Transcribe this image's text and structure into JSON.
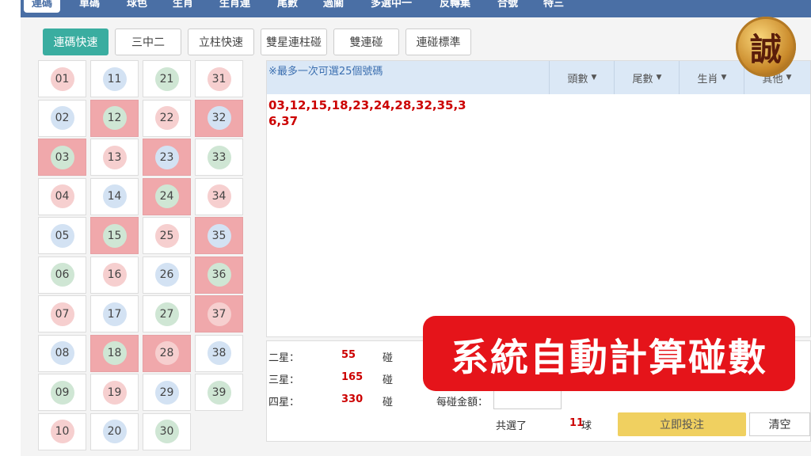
{
  "nav": {
    "tabs": [
      "連碼",
      "單碼",
      "球色",
      "生肖",
      "生肖連",
      "尾數",
      "過關",
      "多選中一",
      "反轉集",
      "合號",
      "特三"
    ]
  },
  "toolbar": {
    "buttons": [
      "連碼快速",
      "三中二",
      "立柱快速",
      "雙星連柱碰",
      "雙連碰",
      "連碰標準"
    ],
    "active": "連碼快速"
  },
  "grid": {
    "numbers": [
      [
        "01",
        "11",
        "21",
        "31"
      ],
      [
        "02",
        "12",
        "22",
        "32"
      ],
      [
        "03",
        "13",
        "23",
        "33"
      ],
      [
        "04",
        "14",
        "24",
        "34"
      ],
      [
        "05",
        "15",
        "25",
        "35"
      ],
      [
        "06",
        "16",
        "26",
        "36"
      ],
      [
        "07",
        "17",
        "27",
        "37"
      ],
      [
        "08",
        "18",
        "28",
        "38"
      ],
      [
        "09",
        "19",
        "29",
        "39"
      ],
      [
        "10",
        "20",
        "30",
        ""
      ]
    ],
    "selected": [
      "03",
      "12",
      "15",
      "18",
      "23",
      "24",
      "28",
      "32",
      "35",
      "36",
      "37"
    ]
  },
  "panel": {
    "notice": "※最多一次可選25個號碼",
    "filters": [
      "頭數",
      "尾數",
      "生肖",
      "其他"
    ],
    "selected_text": "03,12,15,18,23,24,28,32,35,36,37"
  },
  "summary": {
    "rows": [
      {
        "label": "二星：",
        "value": "55",
        "unit": "碰"
      },
      {
        "label": "三星：",
        "value": "165",
        "unit": "碰"
      },
      {
        "label": "四星：",
        "value": "330",
        "unit": "碰"
      }
    ],
    "amount_label": "每碰金額：",
    "total_prefix": "共選了",
    "total_count": "11",
    "total_unit": "球",
    "bet_button": "立即投注",
    "clear_button": "清空"
  },
  "banner": {
    "text": "系統自動計算碰數"
  },
  "logo": {
    "glyph": "誠"
  },
  "colors": {
    "accent": "#3aada0",
    "selected_cell": "#f0a8ab",
    "banner": "#e5141a",
    "bet": "#f0d060"
  }
}
